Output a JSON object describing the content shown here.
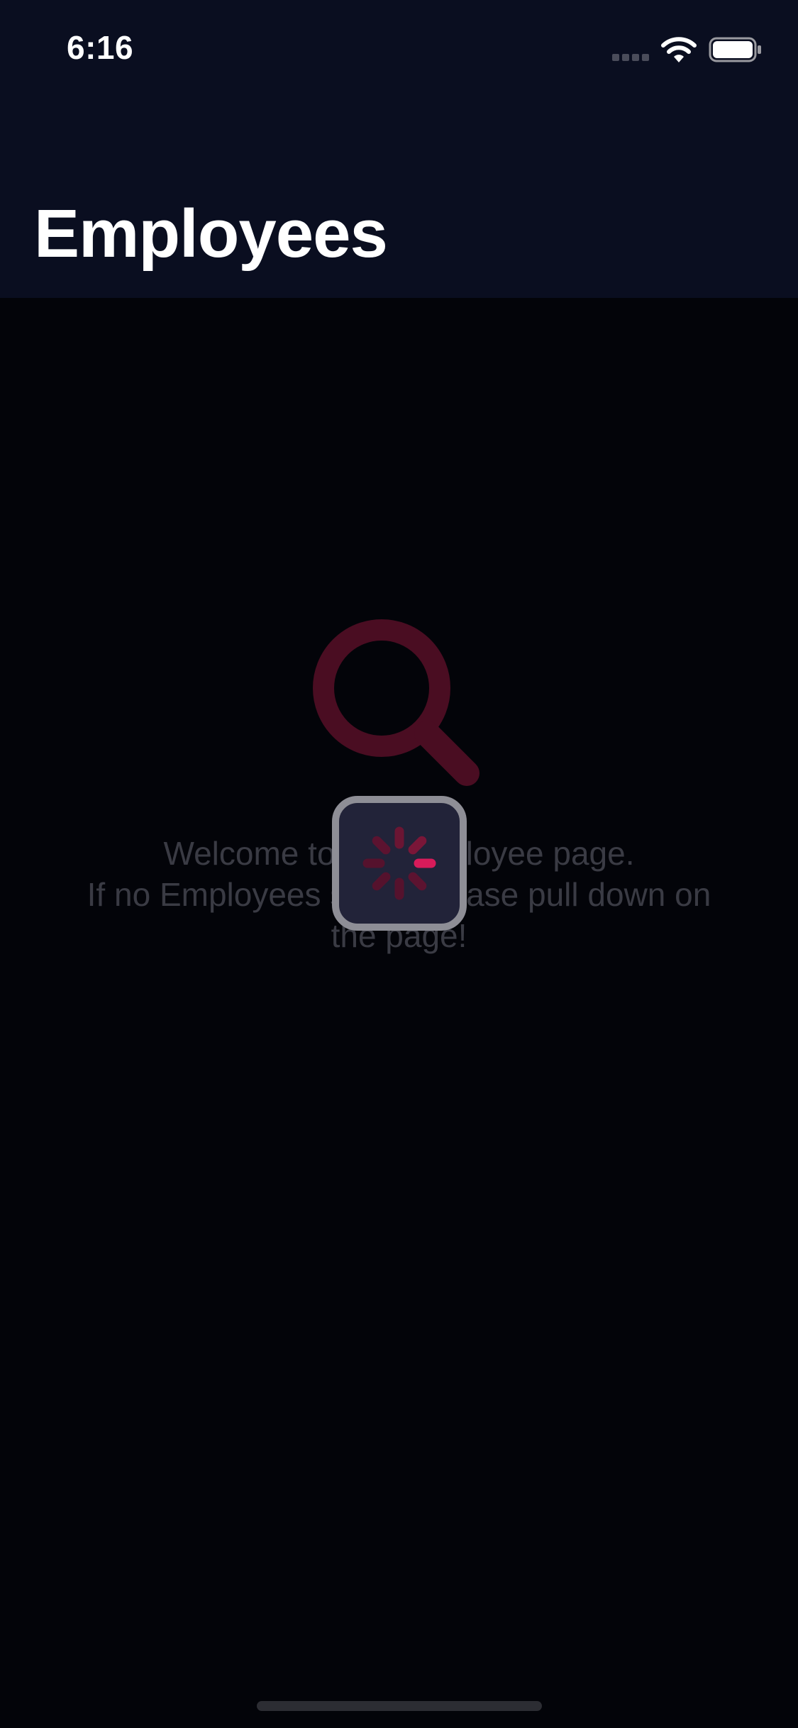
{
  "status_bar": {
    "time": "6:16"
  },
  "header": {
    "title": "Employees"
  },
  "empty_state": {
    "icon": "search-icon",
    "line1": "Welcome to the Employee page.",
    "line2": "If no Employees show, please pull down on",
    "line3": "the page!"
  },
  "loading": {
    "icon": "spinner-icon"
  },
  "colors": {
    "header_bg": "#0a0e20",
    "body_bg": "#030409",
    "accent": "#d81b5a",
    "accent_dim": "#4a0d22",
    "hud_bg": "#222339",
    "hud_border": "#8e8e96",
    "muted_text": "#3a3b44"
  }
}
